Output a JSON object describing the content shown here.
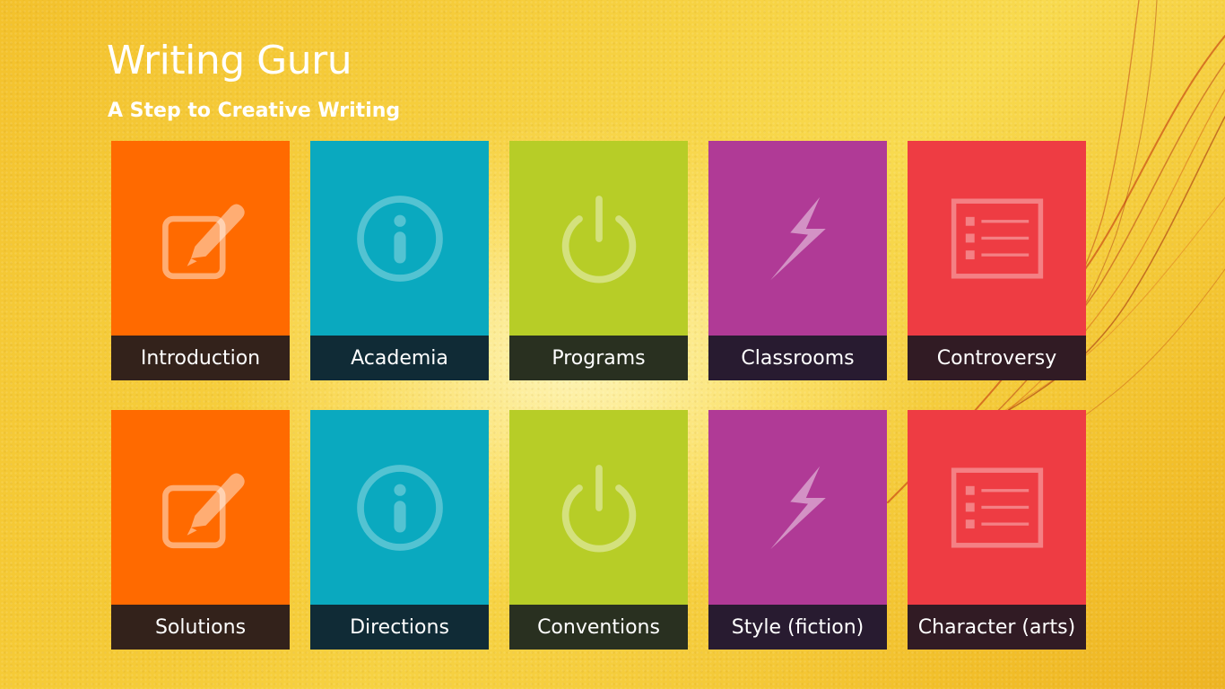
{
  "app": {
    "title": "Writing Guru",
    "subtitle": "A Step to Creative Writing"
  },
  "colors": {
    "orange": "#ff6a00",
    "teal": "#0aa9bf",
    "lime": "#b7cd27",
    "purple": "#b03a96",
    "red": "#ee3c43",
    "label_bar": "#121620"
  },
  "tiles": [
    {
      "label": "Introduction",
      "icon": "edit-icon",
      "color": "orange"
    },
    {
      "label": "Academia",
      "icon": "info-icon",
      "color": "teal"
    },
    {
      "label": "Programs",
      "icon": "power-icon",
      "color": "lime"
    },
    {
      "label": "Classrooms",
      "icon": "lightning-icon",
      "color": "purple"
    },
    {
      "label": "Controversy",
      "icon": "list-icon",
      "color": "red"
    },
    {
      "label": "Solutions",
      "icon": "edit-icon",
      "color": "orange"
    },
    {
      "label": "Directions",
      "icon": "info-icon",
      "color": "teal"
    },
    {
      "label": "Conventions",
      "icon": "power-icon",
      "color": "lime"
    },
    {
      "label": "Style (fiction)",
      "icon": "lightning-icon",
      "color": "purple"
    },
    {
      "label": "Character (arts)",
      "icon": "list-icon",
      "color": "red"
    }
  ]
}
